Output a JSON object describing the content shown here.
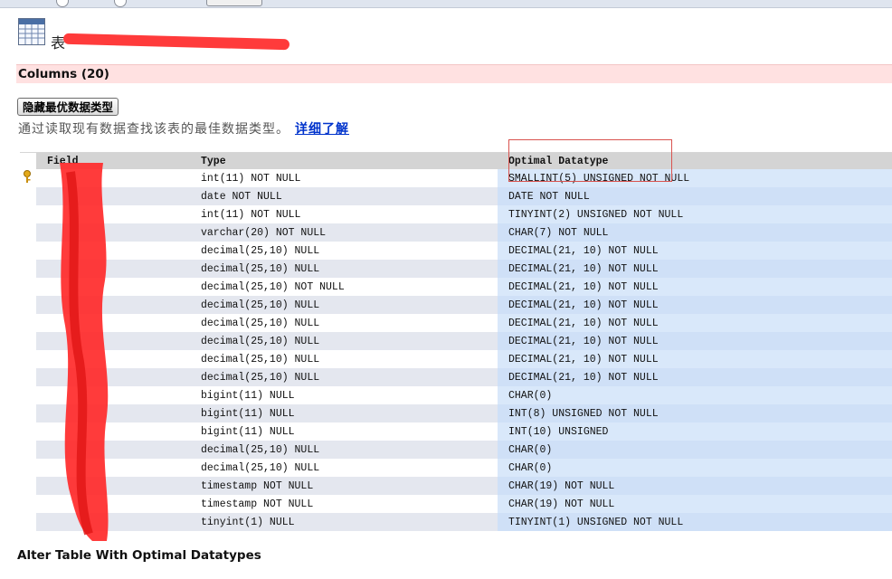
{
  "page": {
    "title_visible": "表",
    "columns_heading": "Columns (20)",
    "hide_button_label": "隐藏最优数据类型",
    "description": "通过读取现有数据查找该表的最佳数据类型。",
    "description_link": "详细了解",
    "footer_heading": "Alter Table With Optimal Datatypes"
  },
  "table": {
    "headers": [
      "Field",
      "Type",
      "Optimal Datatype"
    ],
    "rows": [
      {
        "field": "",
        "type": "int(11) NOT NULL",
        "optimal": "SMALLINT(5) UNSIGNED NOT NULL",
        "key": true
      },
      {
        "field": "",
        "type": "date NOT NULL",
        "optimal": "DATE NOT NULL"
      },
      {
        "field": "",
        "type": "int(11) NOT NULL",
        "optimal": "TINYINT(2) UNSIGNED NOT NULL"
      },
      {
        "field": "",
        "type": "varchar(20) NOT NULL",
        "optimal": "CHAR(7) NOT NULL"
      },
      {
        "field": "",
        "type": "decimal(25,10) NULL",
        "optimal": "DECIMAL(21, 10) NOT NULL"
      },
      {
        "field": "",
        "type": "decimal(25,10) NULL",
        "optimal": "DECIMAL(21, 10) NOT NULL"
      },
      {
        "field": "",
        "type": "decimal(25,10) NOT NULL",
        "optimal": "DECIMAL(21, 10) NOT NULL"
      },
      {
        "field": "",
        "type": "decimal(25,10) NULL",
        "optimal": "DECIMAL(21, 10) NOT NULL"
      },
      {
        "field": "",
        "type": "decimal(25,10) NULL",
        "optimal": "DECIMAL(21, 10) NOT NULL"
      },
      {
        "field": "",
        "type": "decimal(25,10) NULL",
        "optimal": "DECIMAL(21, 10) NOT NULL"
      },
      {
        "field": "",
        "type": "decimal(25,10) NULL",
        "optimal": "DECIMAL(21, 10) NOT NULL"
      },
      {
        "field": "",
        "type": "decimal(25,10) NULL",
        "optimal": "DECIMAL(21, 10) NOT NULL"
      },
      {
        "field": "",
        "type": "bigint(11) NULL",
        "optimal": "CHAR(0)"
      },
      {
        "field": "",
        "type": "bigint(11) NULL",
        "optimal": "INT(8) UNSIGNED NOT NULL"
      },
      {
        "field": "",
        "type": "bigint(11) NULL",
        "optimal": "INT(10) UNSIGNED"
      },
      {
        "field": "",
        "type": "decimal(25,10) NULL",
        "optimal": "CHAR(0)"
      },
      {
        "field": "",
        "type": "decimal(25,10) NULL",
        "optimal": "CHAR(0)"
      },
      {
        "field": "",
        "type": "timestamp NOT NULL",
        "optimal": "CHAR(19) NOT NULL"
      },
      {
        "field": "",
        "type": "timestamp NOT NULL",
        "optimal": "CHAR(19) NOT NULL"
      },
      {
        "field": "",
        "type": "tinyint(1) NULL",
        "optimal": "TINYINT(1) UNSIGNED NOT NULL"
      }
    ]
  },
  "colors": {
    "columns_band": "#ffe1e1",
    "optimal_col": "#d9e8fa",
    "highlight_box": "#d9534f",
    "redaction": "#ff2a2a",
    "link": "#0033cc"
  },
  "icons": [
    "table-icon",
    "primary-key-icon"
  ]
}
